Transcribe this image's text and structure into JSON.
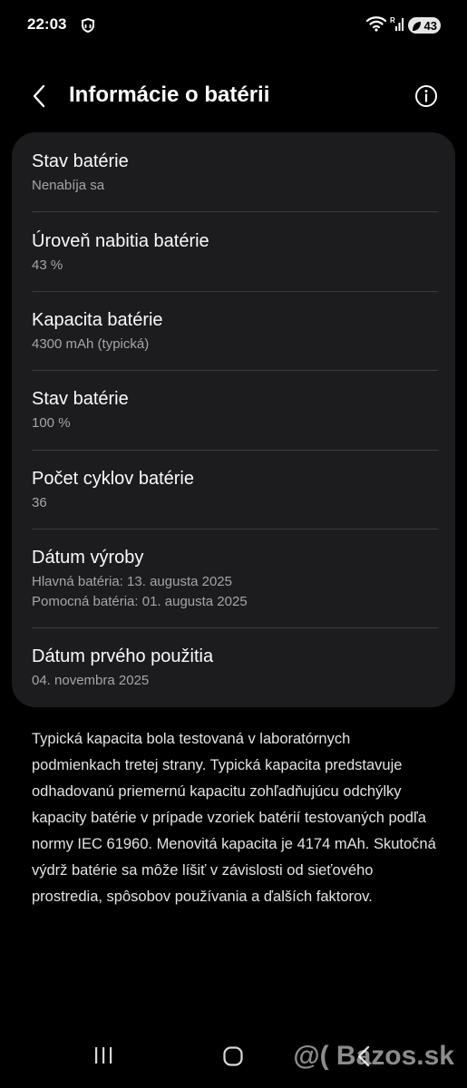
{
  "status_bar": {
    "time": "22:03",
    "battery_level": "43",
    "icons": [
      "shield-icon",
      "wifi-icon",
      "signal-icon",
      "battery-saver-icon"
    ]
  },
  "header": {
    "title": "Informácie o batérii",
    "back_icon": "back-arrow-icon",
    "info_icon": "info-icon"
  },
  "battery_info": {
    "rows": [
      {
        "title": "Stav batérie",
        "lines": [
          "Nenabíja sa"
        ]
      },
      {
        "title": "Úroveň nabitia batérie",
        "lines": [
          "43 %"
        ]
      },
      {
        "title": "Kapacita batérie",
        "lines": [
          "4300 mAh (typická)"
        ]
      },
      {
        "title": "Stav batérie",
        "lines": [
          "100 %"
        ]
      },
      {
        "title": "Počet cyklov batérie",
        "lines": [
          "36"
        ]
      },
      {
        "title": "Dátum výroby",
        "lines": [
          "Hlavná batéria: 13. augusta 2025",
          "Pomocná batéria: 01. augusta 2025"
        ]
      },
      {
        "title": "Dátum prvého použitia",
        "lines": [
          "04. novembra 2025"
        ]
      }
    ]
  },
  "footnote": "Typická kapacita bola testovaná v laboratórnych podmienkach tretej strany. Typická kapacita predstavuje odhadovanú priemernú kapacitu zohľadňujúcu odchýlky kapacity batérie v prípade vzoriek batérií testovaných podľa normy IEC 61960. Menovitá kapacita je 4174 mAh. Skutočná výdrž batérie sa môže líšiť v závislosti od sieťového prostredia, spôsobov používania a ďalších faktorov.",
  "nav_bar": {
    "icons": [
      "recents-icon",
      "home-icon",
      "back-icon"
    ]
  },
  "watermark": "@( Bazos.sk",
  "colors": {
    "background": "#000000",
    "card": "#1c1c1e",
    "divider": "#3b3b3d",
    "title_text": "#fafafa",
    "secondary_text": "#a5a5a5"
  }
}
